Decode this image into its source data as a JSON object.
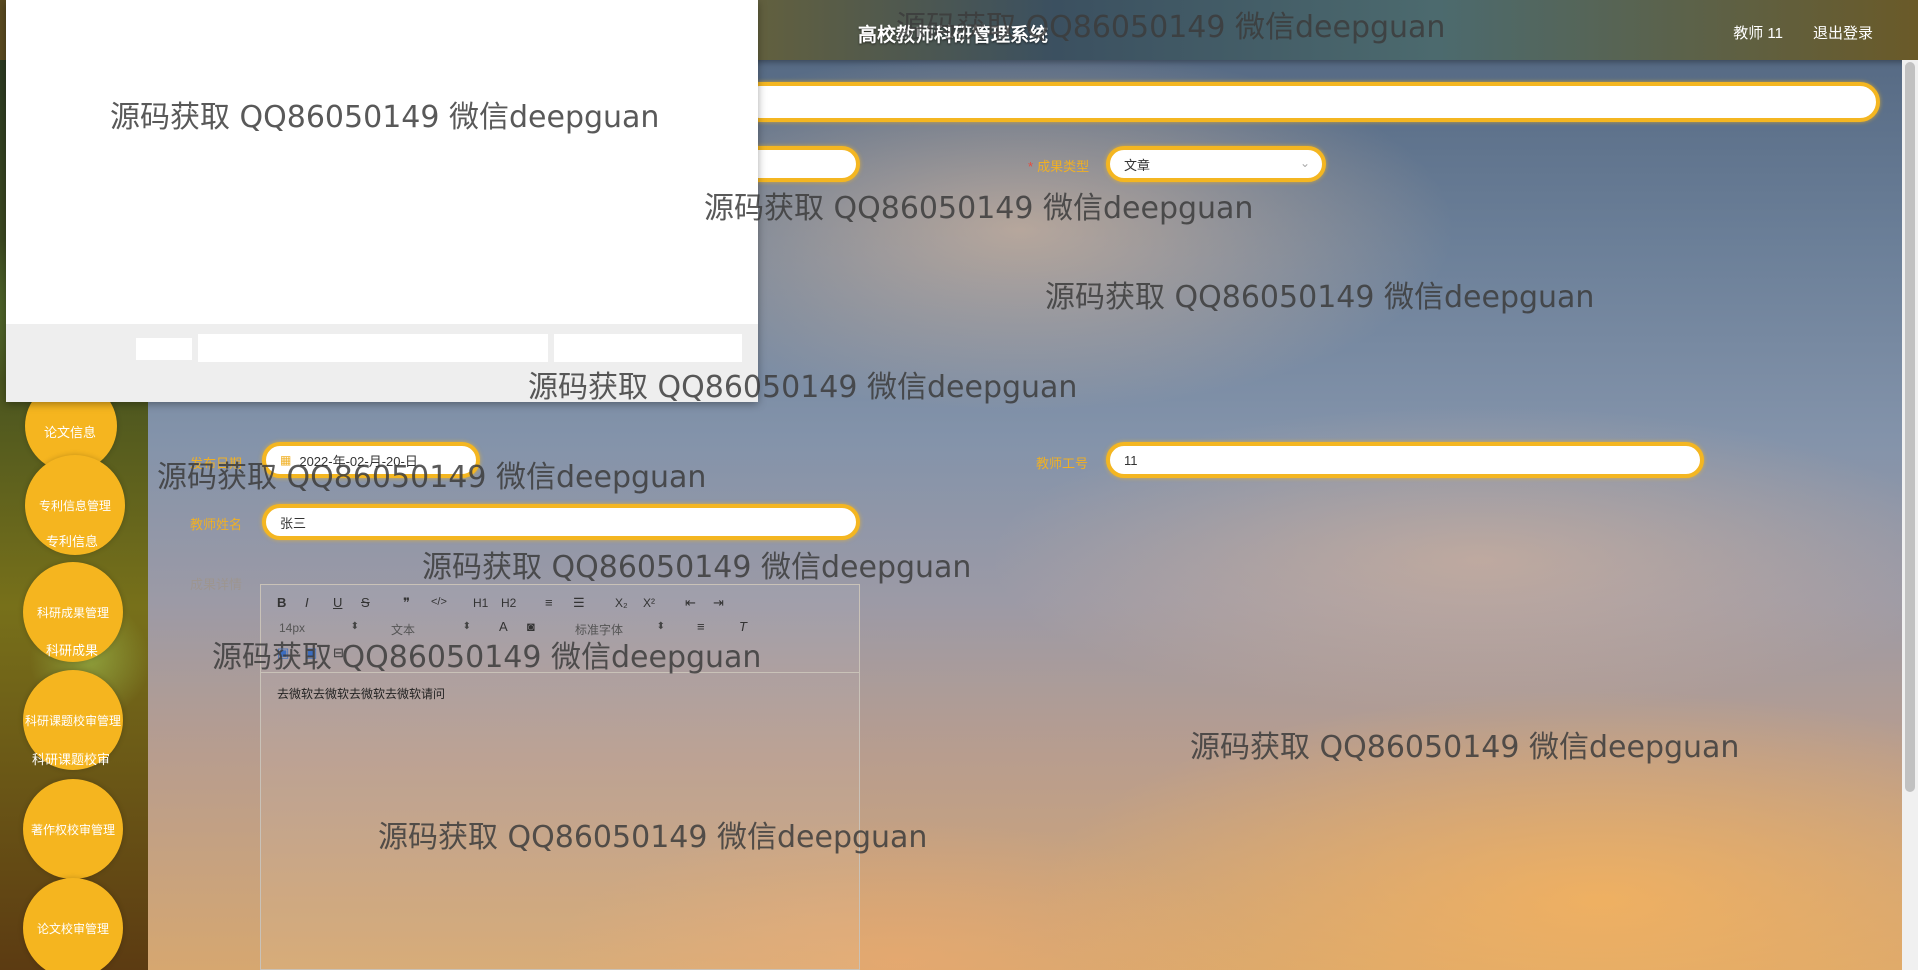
{
  "header": {
    "title": "高校教师科研管理系统",
    "user": "教师 11",
    "logout": "退出登录"
  },
  "sidebar": {
    "items": [
      {
        "circle": "",
        "sub": "论文信息"
      },
      {
        "circle": "专利信息管理",
        "sub": "专利信息"
      },
      {
        "circle": "科研成果管理",
        "sub": "科研成果"
      },
      {
        "circle": "科研课题校审管理",
        "sub": "科研课题校审"
      },
      {
        "circle": "著作权校审管理",
        "sub": ""
      },
      {
        "circle": "论文校审管理",
        "sub": ""
      }
    ]
  },
  "form": {
    "result_type_label": "成果类型",
    "result_type_value": "文章",
    "publish_date_label": "发布日期",
    "publish_date_value": "2022-年-02-月-20-日",
    "teacher_id_label": "教师工号",
    "teacher_id_value": "11",
    "teacher_name_label": "教师姓名",
    "teacher_name_value": "张三",
    "detail_label": "成果详情"
  },
  "editor": {
    "toolbar_row1": [
      "B",
      "I",
      "U",
      "S",
      "❞",
      "</>",
      "H1",
      "H2",
      "≡",
      "☰",
      "X₂",
      "X²",
      "⇤",
      "⇥"
    ],
    "font_size": "14px",
    "text_type": "文本",
    "font_family": "标准字体",
    "content": "去微软去微软去微软去微软请问"
  },
  "watermark": "源码获取 QQ86050149 微信deepguan"
}
